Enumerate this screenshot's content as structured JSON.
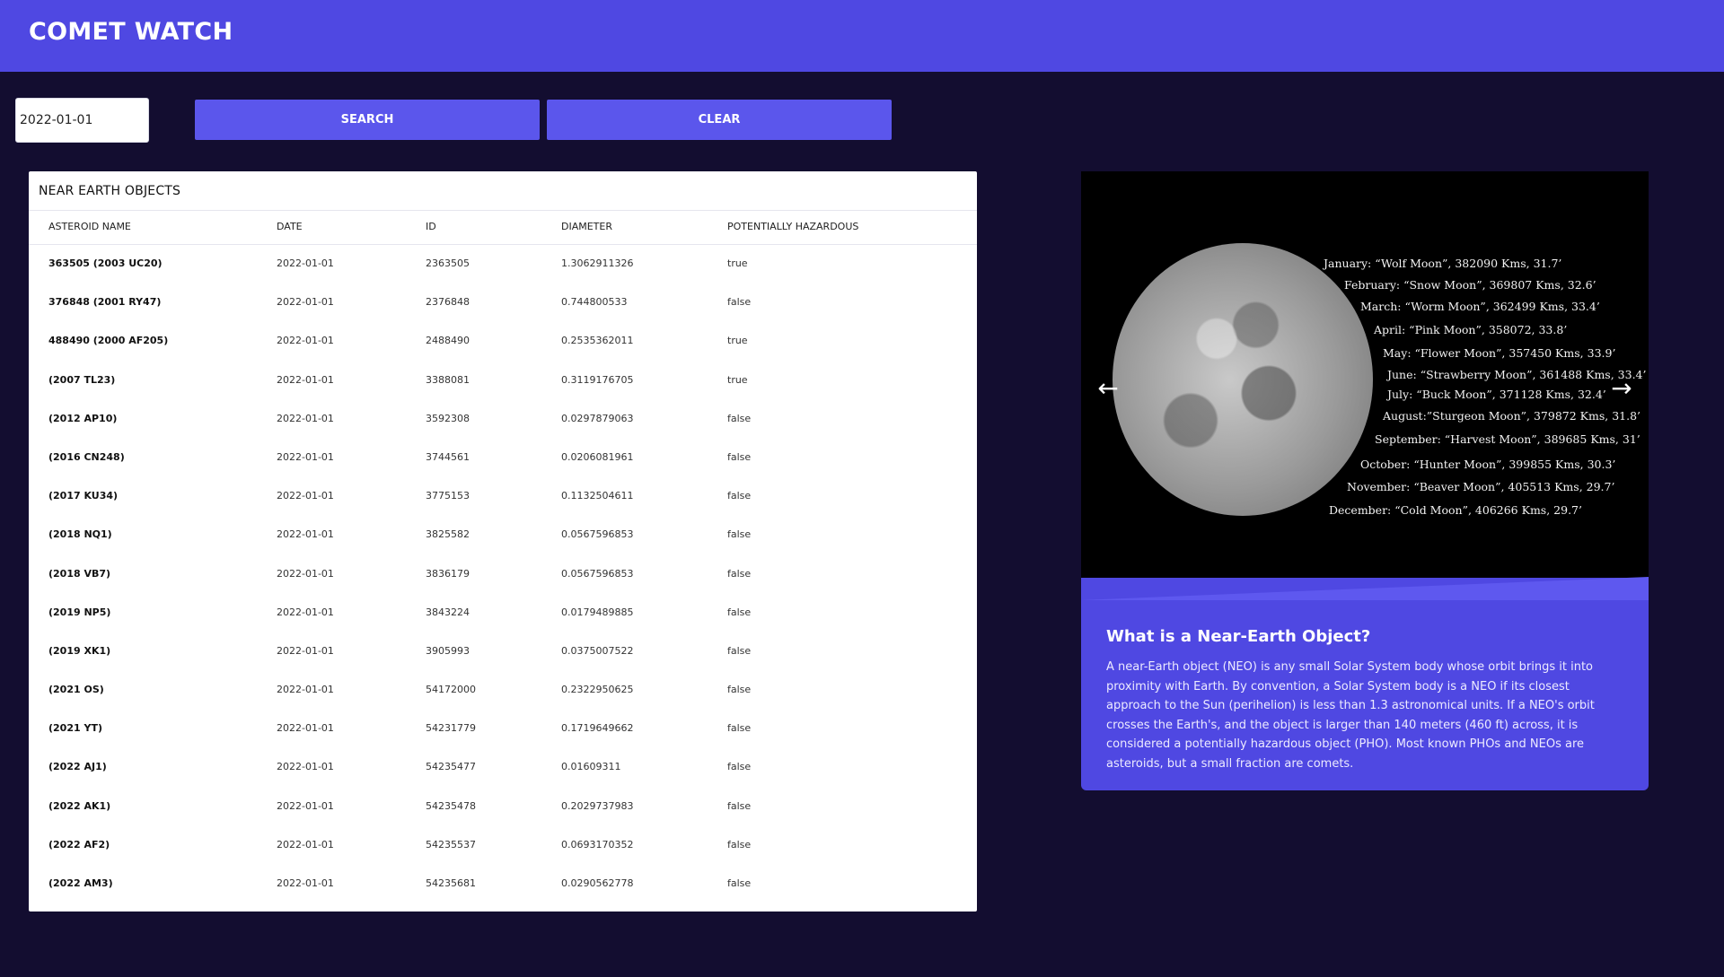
{
  "header": {
    "title": "COMET WATCH"
  },
  "search": {
    "date_value": "2022-01-01",
    "search_label": "SEARCH",
    "clear_label": "CLEAR"
  },
  "table": {
    "title": "NEAR EARTH OBJECTS",
    "columns": [
      "ASTEROID NAME",
      "DATE",
      "ID",
      "DIAMETER",
      "POTENTIALLY HAZARDOUS"
    ],
    "rows": [
      [
        "363505 (2003 UC20)",
        "2022-01-01",
        "2363505",
        "1.3062911326",
        "true"
      ],
      [
        "376848 (2001 RY47)",
        "2022-01-01",
        "2376848",
        "0.744800533",
        "false"
      ],
      [
        "488490 (2000 AF205)",
        "2022-01-01",
        "2488490",
        "0.2535362011",
        "true"
      ],
      [
        "(2007 TL23)",
        "2022-01-01",
        "3388081",
        "0.3119176705",
        "true"
      ],
      [
        "(2012 AP10)",
        "2022-01-01",
        "3592308",
        "0.0297879063",
        "false"
      ],
      [
        "(2016 CN248)",
        "2022-01-01",
        "3744561",
        "0.0206081961",
        "false"
      ],
      [
        "(2017 KU34)",
        "2022-01-01",
        "3775153",
        "0.1132504611",
        "false"
      ],
      [
        "(2018 NQ1)",
        "2022-01-01",
        "3825582",
        "0.0567596853",
        "false"
      ],
      [
        "(2018 VB7)",
        "2022-01-01",
        "3836179",
        "0.0567596853",
        "false"
      ],
      [
        "(2019 NP5)",
        "2022-01-01",
        "3843224",
        "0.0179489885",
        "false"
      ],
      [
        "(2019 XK1)",
        "2022-01-01",
        "3905993",
        "0.0375007522",
        "false"
      ],
      [
        "(2021 OS)",
        "2022-01-01",
        "54172000",
        "0.2322950625",
        "false"
      ],
      [
        "(2021 YT)",
        "2022-01-01",
        "54231779",
        "0.1719649662",
        "false"
      ],
      [
        "(2022 AJ1)",
        "2022-01-01",
        "54235477",
        "0.01609311",
        "false"
      ],
      [
        "(2022 AK1)",
        "2022-01-01",
        "54235478",
        "0.2029737983",
        "false"
      ],
      [
        "(2022 AF2)",
        "2022-01-01",
        "54235537",
        "0.0693170352",
        "false"
      ],
      [
        "(2022 AM3)",
        "2022-01-01",
        "54235681",
        "0.0290562778",
        "false"
      ]
    ]
  },
  "carousel": {
    "image_labels": [
      "January: “Wolf Moon”, 382090 Kms, 31.7’",
      "February: “Snow Moon”, 369807 Kms, 32.6’",
      "March: “Worm Moon”, 362499 Kms, 33.4’",
      "April: “Pink Moon”, 358072, 33.8’",
      "May: “Flower Moon”, 357450 Kms, 33.9’",
      "June: “Strawberry Moon”, 361488 Kms, 33.4’",
      "July: “Buck Moon”, 371128 Kms, 32.4’",
      "August:”Sturgeon Moon”, 379872 Kms, 31.8’",
      "September: “Harvest Moon”, 389685 Kms, 31’",
      "October: “Hunter Moon”, 399855 Kms, 30.3’",
      "November: “Beaver Moon”, 405513 Kms, 29.7’",
      "December: “Cold Moon”, 406266 Kms, 29.7’"
    ],
    "prev_icon": "arrow-left-icon",
    "next_icon": "arrow-right-icon"
  },
  "info": {
    "title": "What is a Near-Earth Object?",
    "body": "A near-Earth object (NEO) is any small Solar System body whose orbit brings it into proximity with Earth. By convention, a Solar System body is a NEO if its closest approach to the Sun (perihelion) is less than 1.3 astronomical units. If a NEO's orbit crosses the Earth's, and the object is larger than 140 meters (460 ft) across, it is considered a potentially hazardous object (PHO). Most known PHOs and NEOs are asteroids, but a small fraction are comets."
  },
  "colors": {
    "background": "#130d30",
    "header": "#4f48e2",
    "button": "#5b56ec",
    "card": "#ffffff"
  }
}
